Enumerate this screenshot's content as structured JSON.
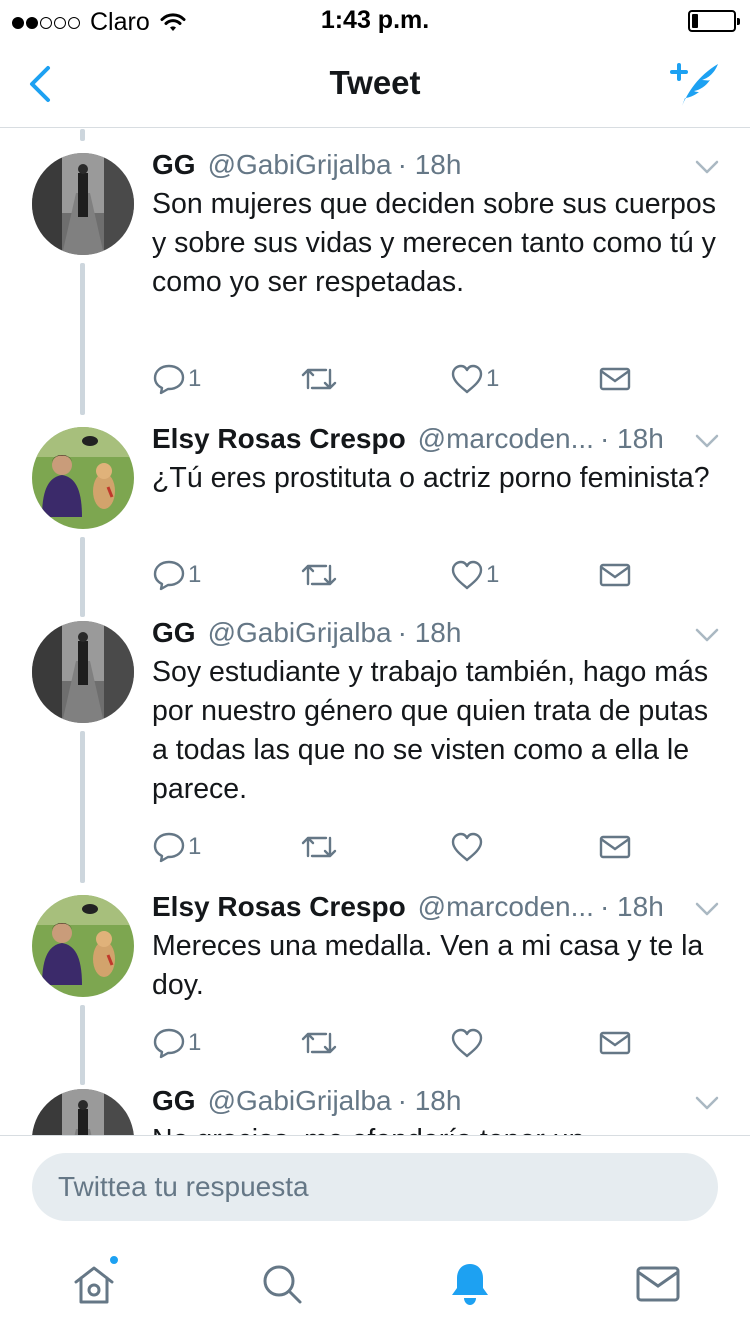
{
  "status_bar": {
    "carrier": "Claro",
    "time": "1:43 p.m.",
    "signal_bars_filled": 2,
    "signal_bars_total": 5,
    "battery_level": 0.12
  },
  "nav": {
    "title": "Tweet",
    "back_icon": "chevron-left-icon",
    "compose_icon": "compose-tweet-icon"
  },
  "colors": {
    "accent": "#1da1f2",
    "text_primary": "#14171a",
    "text_secondary": "#657786",
    "thread_line": "#cdd6dd"
  },
  "tweets": [
    {
      "name": "GG",
      "handle": "@GabiGrijalba",
      "time": "· 18h",
      "text": "Son mujeres que deciden sobre sus cuerpos y sobre sus vidas y merecen tanto como tú y como yo ser respetadas.",
      "replies": "1",
      "retweets": "",
      "likes": "1"
    },
    {
      "name": "Elsy Rosas Crespo",
      "handle": "@marcoden...",
      "time": "· 18h",
      "text": "¿Tú eres prostituta o actriz porno feminista?",
      "replies": "1",
      "retweets": "",
      "likes": "1"
    },
    {
      "name": "GG",
      "handle": "@GabiGrijalba",
      "time": "· 18h",
      "text": "Soy estudiante y trabajo también, hago más por nuestro género que quien trata de putas a todas las que no se visten como a ella le parece.",
      "replies": "1",
      "retweets": "",
      "likes": ""
    },
    {
      "name": "Elsy Rosas Crespo",
      "handle": "@marcoden...",
      "time": "· 18h",
      "text": "Mereces una medalla. Ven a mi casa y te la doy.",
      "replies": "1",
      "retweets": "",
      "likes": ""
    },
    {
      "name": "GG",
      "handle": "@GabiGrijalba",
      "time": "· 18h",
      "text": "No gracias, me ofendería tener un",
      "replies": "",
      "retweets": "",
      "likes": ""
    }
  ],
  "reply": {
    "placeholder": "Twittea tu respuesta"
  },
  "tab_bar": {
    "items": [
      "home-icon",
      "search-icon",
      "notifications-icon",
      "messages-icon"
    ],
    "active": "notifications-icon"
  }
}
